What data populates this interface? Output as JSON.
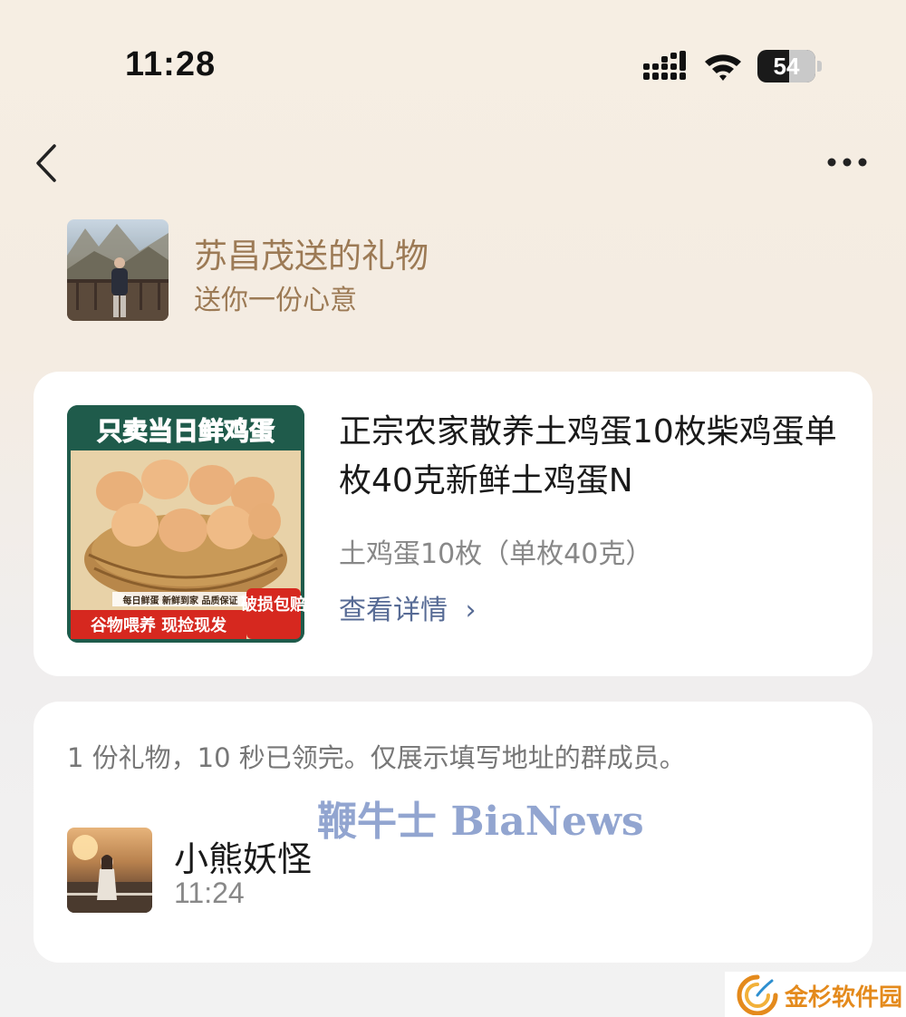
{
  "status_bar": {
    "time": "11:28",
    "battery": "54"
  },
  "nav": {
    "back_icon": "chevron-left-icon",
    "more_icon": "more-horizontal-icon"
  },
  "sender": {
    "title": "苏昌茂送的礼物",
    "subtitle": "送你一份心意"
  },
  "product": {
    "image_banner": "只卖当日鲜鸡蛋",
    "image_tag_small": "每日鲜蛋 新鲜到家 品质保证",
    "image_tag_bottom": "谷物喂养 现捡现发",
    "image_badge": "破损包赔",
    "title": "正宗农家散养土鸡蛋10枚柴鸡蛋单枚40克新鲜土鸡蛋N",
    "spec": "土鸡蛋10枚（单枚40克）",
    "detail_link": "查看详情",
    "detail_chevron": "›"
  },
  "receivers": {
    "info": "1 份礼物，10 秒已领完。仅展示填写地址的群成员。",
    "watermark": "鞭牛士 BiaNews",
    "items": [
      {
        "name": "小熊妖怪",
        "time": "11:24"
      }
    ]
  },
  "corner_logo": {
    "text": "金杉软件园"
  },
  "colors": {
    "accent_brown": "#9c7a55",
    "link_blue": "#576b95",
    "egg_red": "#d6281f",
    "logo_orange": "#e48a1c"
  }
}
